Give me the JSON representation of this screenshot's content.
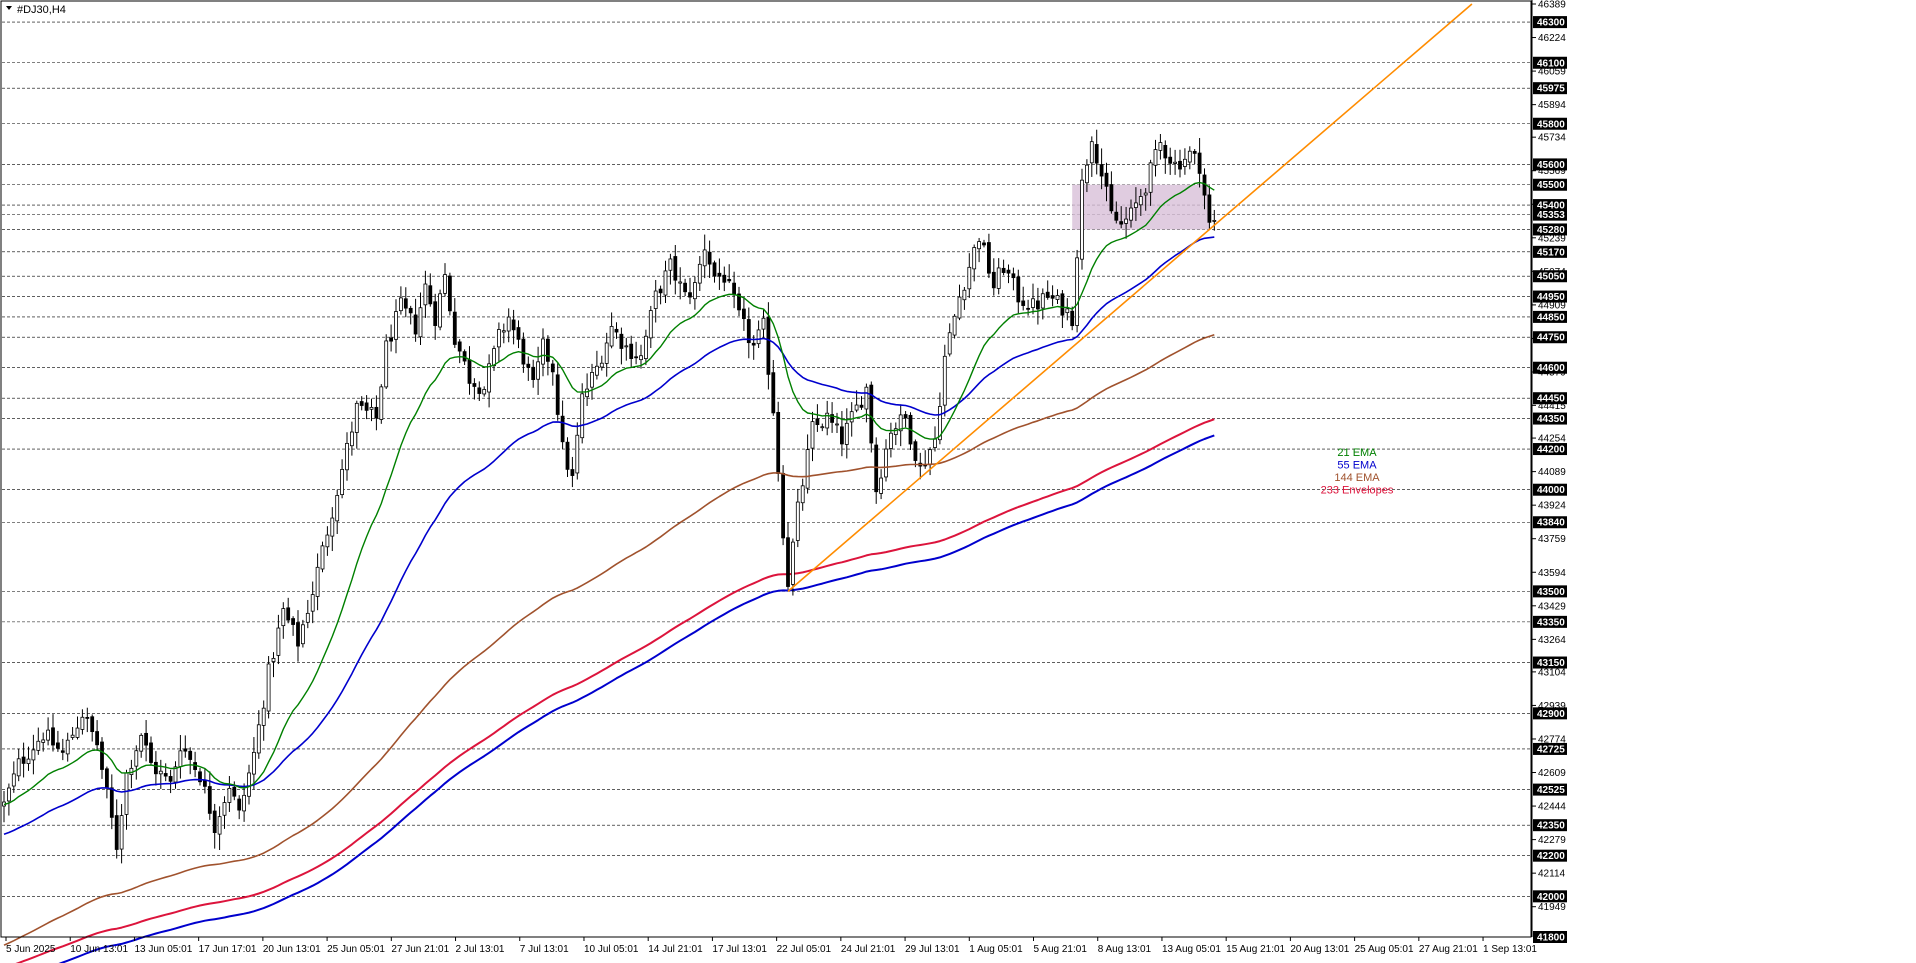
{
  "chart_data": {
    "type": "candlestick",
    "title": "#DJ30,H4",
    "y_range": [
      41800,
      46389
    ],
    "price_tick_labels": [
      46389,
      46224,
      46059,
      45894,
      45734,
      45569,
      45404,
      45239,
      45074,
      44909,
      44744,
      44579,
      44415,
      44254,
      44089,
      43924,
      43759,
      43594,
      43429,
      43264,
      43104,
      42939,
      42774,
      42609,
      42444,
      42279,
      42114,
      41949
    ],
    "level_lines": [
      46300,
      46100,
      45975,
      45800,
      45600,
      45500,
      45400,
      45353,
      45280,
      45170,
      45050,
      44950,
      44850,
      44750,
      44600,
      44450,
      44350,
      44200,
      44000,
      43840,
      43500,
      43350,
      43150,
      42900,
      42725,
      42525,
      42350,
      42200,
      42000,
      41800
    ],
    "time_labels": [
      "5 Jun 2025",
      "10 Jun 13:01",
      "13 Jun 05:01",
      "17 Jun 17:01",
      "20 Jun 13:01",
      "25 Jun 05:01",
      "27 Jun 21:01",
      "2 Jul 13:01",
      "7 Jul 13:01",
      "10 Jul 05:01",
      "14 Jul 21:01",
      "17 Jul 13:01",
      "22 Jul 05:01",
      "24 Jul 21:01",
      "29 Jul 13:01",
      "1 Aug 05:01",
      "5 Aug 21:01",
      "8 Aug 13:01",
      "13 Aug 05:01",
      "15 Aug 21:01",
      "20 Aug 13:01",
      "25 Aug 05:01",
      "27 Aug 21:01",
      "1 Sep 13:01"
    ],
    "price_anchors": [
      [
        0,
        42450
      ],
      [
        3,
        42650
      ],
      [
        8,
        42800
      ],
      [
        12,
        42700
      ],
      [
        16,
        42900
      ],
      [
        19,
        42750
      ],
      [
        21,
        42500
      ],
      [
        23,
        42250
      ],
      [
        25,
        42600
      ],
      [
        28,
        42800
      ],
      [
        30,
        42650
      ],
      [
        34,
        42550
      ],
      [
        36,
        42750
      ],
      [
        40,
        42600
      ],
      [
        43,
        42350
      ],
      [
        46,
        42550
      ],
      [
        48,
        42400
      ],
      [
        51,
        42700
      ],
      [
        54,
        43100
      ],
      [
        57,
        43400
      ],
      [
        60,
        43250
      ],
      [
        63,
        43500
      ],
      [
        66,
        43800
      ],
      [
        69,
        44100
      ],
      [
        72,
        44400
      ],
      [
        76,
        44350
      ],
      [
        78,
        44700
      ],
      [
        81,
        44900
      ],
      [
        84,
        44800
      ],
      [
        86,
        45000
      ],
      [
        88,
        44850
      ],
      [
        90,
        45050
      ],
      [
        92,
        44750
      ],
      [
        95,
        44550
      ],
      [
        98,
        44500
      ],
      [
        101,
        44750
      ],
      [
        103,
        44850
      ],
      [
        106,
        44650
      ],
      [
        108,
        44500
      ],
      [
        110,
        44700
      ],
      [
        112,
        44600
      ],
      [
        114,
        44200
      ],
      [
        116,
        44050
      ],
      [
        118,
        44450
      ],
      [
        121,
        44600
      ],
      [
        124,
        44800
      ],
      [
        127,
        44700
      ],
      [
        130,
        44650
      ],
      [
        133,
        44950
      ],
      [
        136,
        45100
      ],
      [
        139,
        44950
      ],
      [
        141,
        45000
      ],
      [
        143,
        45200
      ],
      [
        145,
        45050
      ],
      [
        147,
        45050
      ],
      [
        150,
        44850
      ],
      [
        153,
        44700
      ],
      [
        155,
        44800
      ],
      [
        157,
        44400
      ],
      [
        159,
        43800
      ],
      [
        160,
        43550
      ],
      [
        162,
        43900
      ],
      [
        165,
        44300
      ],
      [
        168,
        44350
      ],
      [
        171,
        44250
      ],
      [
        174,
        44400
      ],
      [
        176,
        44500
      ],
      [
        178,
        44000
      ],
      [
        181,
        44300
      ],
      [
        184,
        44350
      ],
      [
        187,
        44100
      ],
      [
        190,
        44250
      ],
      [
        192,
        44650
      ],
      [
        195,
        44950
      ],
      [
        197,
        45100
      ],
      [
        199,
        45250
      ],
      [
        202,
        45000
      ],
      [
        204,
        45100
      ],
      [
        207,
        44950
      ],
      [
        210,
        44900
      ],
      [
        213,
        44950
      ],
      [
        216,
        44900
      ],
      [
        218,
        44850
      ],
      [
        220,
        45500
      ],
      [
        222,
        45750
      ],
      [
        224,
        45550
      ],
      [
        226,
        45350
      ],
      [
        228,
        45300
      ],
      [
        230,
        45350
      ],
      [
        233,
        45500
      ],
      [
        236,
        45700
      ],
      [
        239,
        45600
      ],
      [
        242,
        45650
      ],
      [
        244,
        45600
      ],
      [
        246,
        45300
      ]
    ],
    "series": [
      {
        "name": "21 EMA",
        "color": "#008000",
        "period": 21
      },
      {
        "name": "55 EMA",
        "color": "#0000cd",
        "period": 55
      },
      {
        "name": "144 EMA",
        "color": "#a0522d",
        "period": 144
      },
      {
        "name": "233 Envelopes",
        "color": "#dc143c",
        "period": 233
      }
    ],
    "support_zone": {
      "from_bar": 218,
      "to_bar": 246,
      "low": 45280,
      "high": 45500,
      "color": "#d8bfd8"
    },
    "trendline": {
      "color": "#ff8c00",
      "start": [
        160,
        43500
      ],
      "through": [
        246,
        45280
      ]
    },
    "colors": {
      "candle": "#000000",
      "grid": "#000000"
    }
  }
}
